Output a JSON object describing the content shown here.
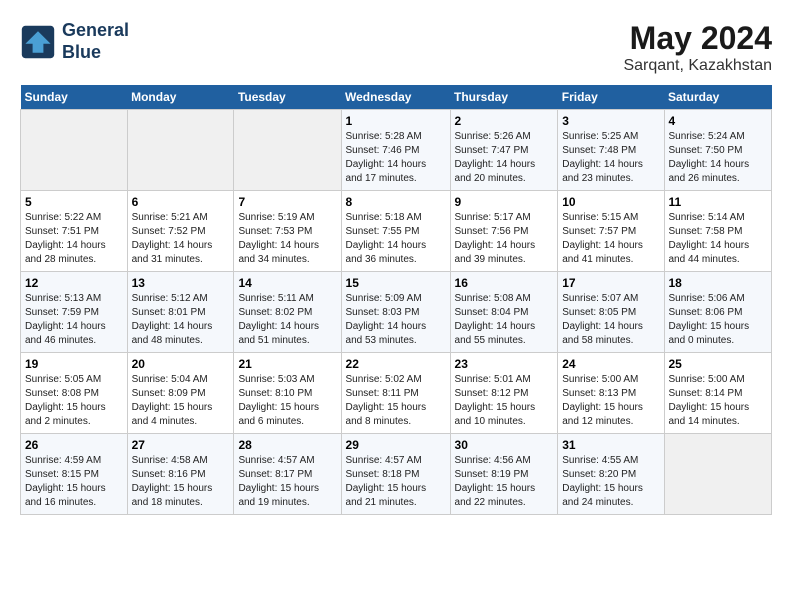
{
  "header": {
    "logo_line1": "General",
    "logo_line2": "Blue",
    "month_year": "May 2024",
    "location": "Sarqant, Kazakhstan"
  },
  "weekdays": [
    "Sunday",
    "Monday",
    "Tuesday",
    "Wednesday",
    "Thursday",
    "Friday",
    "Saturday"
  ],
  "weeks": [
    [
      {
        "day": "",
        "info": ""
      },
      {
        "day": "",
        "info": ""
      },
      {
        "day": "",
        "info": ""
      },
      {
        "day": "1",
        "info": "Sunrise: 5:28 AM\nSunset: 7:46 PM\nDaylight: 14 hours\nand 17 minutes."
      },
      {
        "day": "2",
        "info": "Sunrise: 5:26 AM\nSunset: 7:47 PM\nDaylight: 14 hours\nand 20 minutes."
      },
      {
        "day": "3",
        "info": "Sunrise: 5:25 AM\nSunset: 7:48 PM\nDaylight: 14 hours\nand 23 minutes."
      },
      {
        "day": "4",
        "info": "Sunrise: 5:24 AM\nSunset: 7:50 PM\nDaylight: 14 hours\nand 26 minutes."
      }
    ],
    [
      {
        "day": "5",
        "info": "Sunrise: 5:22 AM\nSunset: 7:51 PM\nDaylight: 14 hours\nand 28 minutes."
      },
      {
        "day": "6",
        "info": "Sunrise: 5:21 AM\nSunset: 7:52 PM\nDaylight: 14 hours\nand 31 minutes."
      },
      {
        "day": "7",
        "info": "Sunrise: 5:19 AM\nSunset: 7:53 PM\nDaylight: 14 hours\nand 34 minutes."
      },
      {
        "day": "8",
        "info": "Sunrise: 5:18 AM\nSunset: 7:55 PM\nDaylight: 14 hours\nand 36 minutes."
      },
      {
        "day": "9",
        "info": "Sunrise: 5:17 AM\nSunset: 7:56 PM\nDaylight: 14 hours\nand 39 minutes."
      },
      {
        "day": "10",
        "info": "Sunrise: 5:15 AM\nSunset: 7:57 PM\nDaylight: 14 hours\nand 41 minutes."
      },
      {
        "day": "11",
        "info": "Sunrise: 5:14 AM\nSunset: 7:58 PM\nDaylight: 14 hours\nand 44 minutes."
      }
    ],
    [
      {
        "day": "12",
        "info": "Sunrise: 5:13 AM\nSunset: 7:59 PM\nDaylight: 14 hours\nand 46 minutes."
      },
      {
        "day": "13",
        "info": "Sunrise: 5:12 AM\nSunset: 8:01 PM\nDaylight: 14 hours\nand 48 minutes."
      },
      {
        "day": "14",
        "info": "Sunrise: 5:11 AM\nSunset: 8:02 PM\nDaylight: 14 hours\nand 51 minutes."
      },
      {
        "day": "15",
        "info": "Sunrise: 5:09 AM\nSunset: 8:03 PM\nDaylight: 14 hours\nand 53 minutes."
      },
      {
        "day": "16",
        "info": "Sunrise: 5:08 AM\nSunset: 8:04 PM\nDaylight: 14 hours\nand 55 minutes."
      },
      {
        "day": "17",
        "info": "Sunrise: 5:07 AM\nSunset: 8:05 PM\nDaylight: 14 hours\nand 58 minutes."
      },
      {
        "day": "18",
        "info": "Sunrise: 5:06 AM\nSunset: 8:06 PM\nDaylight: 15 hours\nand 0 minutes."
      }
    ],
    [
      {
        "day": "19",
        "info": "Sunrise: 5:05 AM\nSunset: 8:08 PM\nDaylight: 15 hours\nand 2 minutes."
      },
      {
        "day": "20",
        "info": "Sunrise: 5:04 AM\nSunset: 8:09 PM\nDaylight: 15 hours\nand 4 minutes."
      },
      {
        "day": "21",
        "info": "Sunrise: 5:03 AM\nSunset: 8:10 PM\nDaylight: 15 hours\nand 6 minutes."
      },
      {
        "day": "22",
        "info": "Sunrise: 5:02 AM\nSunset: 8:11 PM\nDaylight: 15 hours\nand 8 minutes."
      },
      {
        "day": "23",
        "info": "Sunrise: 5:01 AM\nSunset: 8:12 PM\nDaylight: 15 hours\nand 10 minutes."
      },
      {
        "day": "24",
        "info": "Sunrise: 5:00 AM\nSunset: 8:13 PM\nDaylight: 15 hours\nand 12 minutes."
      },
      {
        "day": "25",
        "info": "Sunrise: 5:00 AM\nSunset: 8:14 PM\nDaylight: 15 hours\nand 14 minutes."
      }
    ],
    [
      {
        "day": "26",
        "info": "Sunrise: 4:59 AM\nSunset: 8:15 PM\nDaylight: 15 hours\nand 16 minutes."
      },
      {
        "day": "27",
        "info": "Sunrise: 4:58 AM\nSunset: 8:16 PM\nDaylight: 15 hours\nand 18 minutes."
      },
      {
        "day": "28",
        "info": "Sunrise: 4:57 AM\nSunset: 8:17 PM\nDaylight: 15 hours\nand 19 minutes."
      },
      {
        "day": "29",
        "info": "Sunrise: 4:57 AM\nSunset: 8:18 PM\nDaylight: 15 hours\nand 21 minutes."
      },
      {
        "day": "30",
        "info": "Sunrise: 4:56 AM\nSunset: 8:19 PM\nDaylight: 15 hours\nand 22 minutes."
      },
      {
        "day": "31",
        "info": "Sunrise: 4:55 AM\nSunset: 8:20 PM\nDaylight: 15 hours\nand 24 minutes."
      },
      {
        "day": "",
        "info": ""
      }
    ]
  ]
}
